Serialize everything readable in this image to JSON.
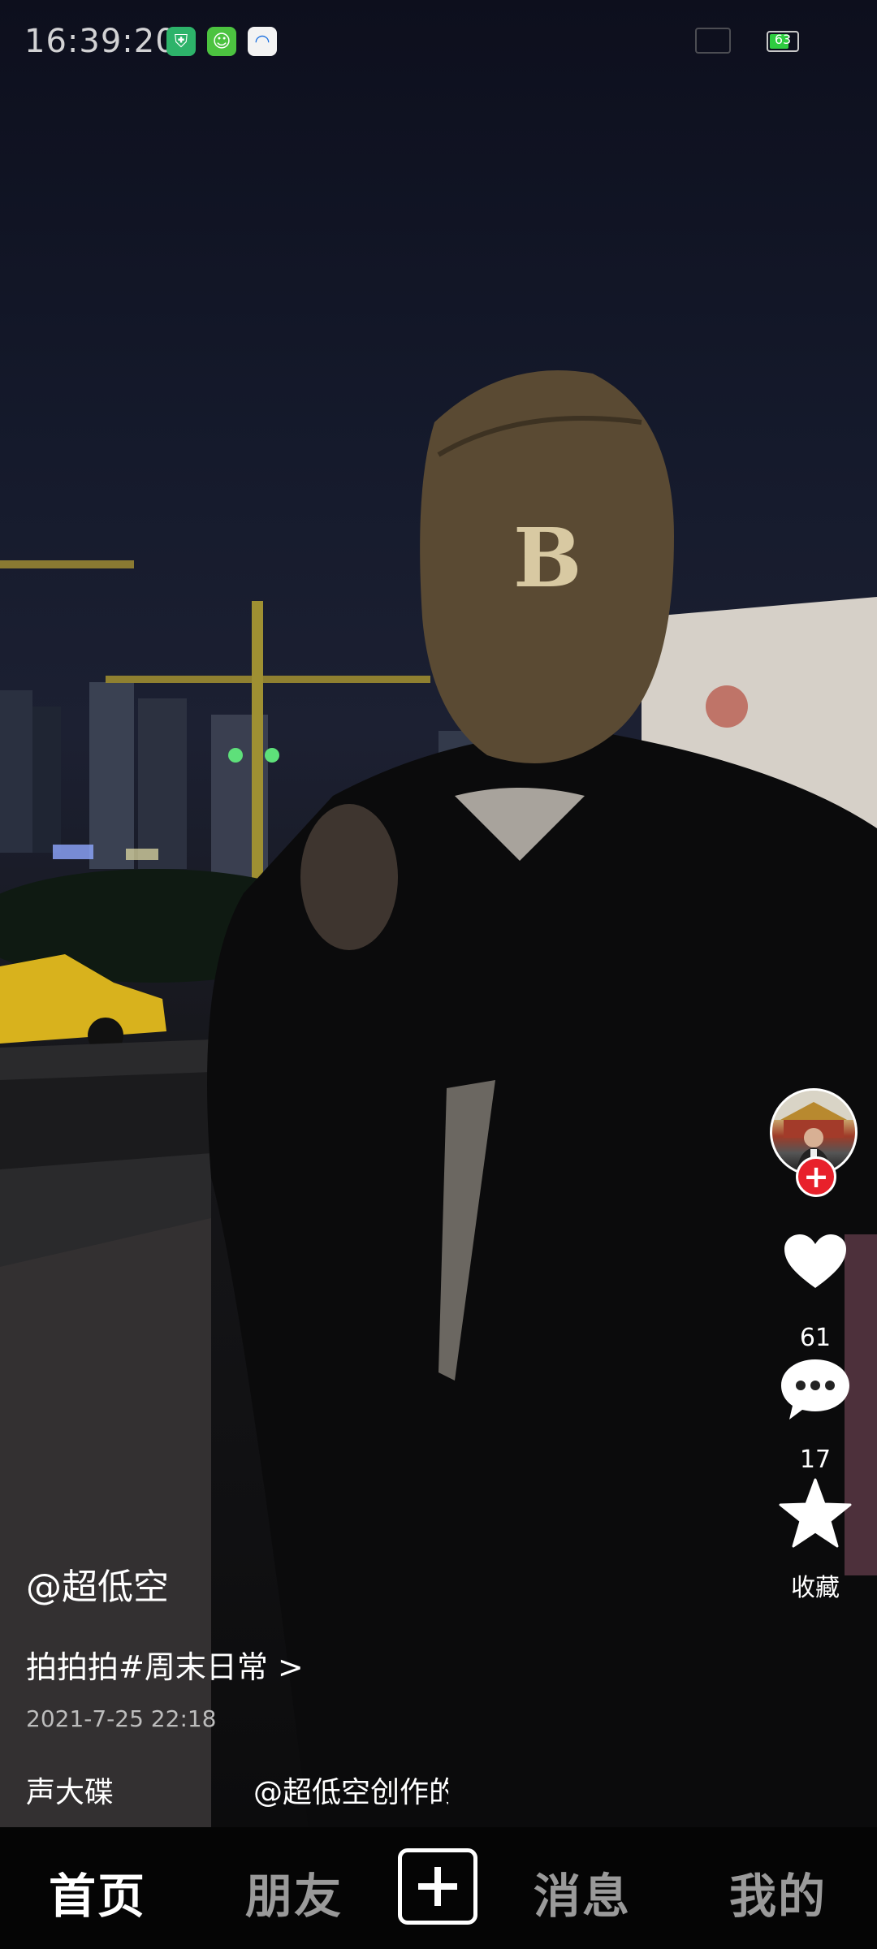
{
  "status_bar": {
    "time": "16:39:20",
    "battery": "63",
    "app_icons": [
      "shield-app-icon",
      "android-app-icon",
      "cloud-app-icon"
    ]
  },
  "video": {
    "author": "@超低空",
    "description": "拍拍拍#周末日常 >",
    "date": "2021-7-25 22:18",
    "music_left": "声大碟",
    "music_right": "@超低空创作的原声"
  },
  "actions": {
    "likes": "61",
    "comments": "17",
    "favorite_label": "收藏"
  },
  "nav": {
    "home": "首页",
    "friends": "朋友",
    "messages": "消息",
    "me": "我的"
  },
  "colors": {
    "follow_red": "#e8212b",
    "nav_bg": "#050505",
    "inactive_nav": "#9a9a9a"
  }
}
